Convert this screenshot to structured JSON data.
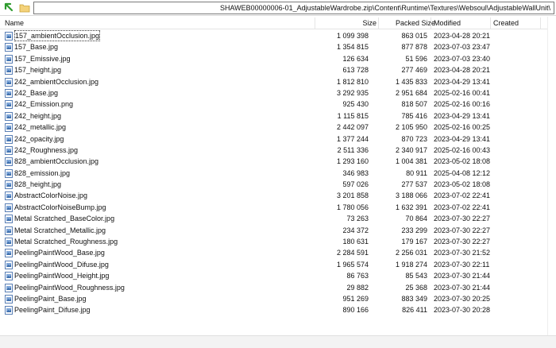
{
  "address": {
    "path": "SHAWEB00000006-01_AdjustableWardrobe.zip\\Content\\Runtime\\Textures\\Websoul\\AdjustableWallUnit\\",
    "up_icon": "green-up-arrow-icon",
    "folder_icon": "folder-icon"
  },
  "columns": {
    "name": "Name",
    "size": "Size",
    "packed": "Packed Size",
    "modified": "Modified",
    "created": "Created"
  },
  "files": [
    {
      "name": "157_ambientOcclusion.jpg",
      "size": "1 099 398",
      "packed": "863 015",
      "modified": "2023-04-28 20:21"
    },
    {
      "name": "157_Base.jpg",
      "size": "1 354 815",
      "packed": "877 878",
      "modified": "2023-07-03 23:47"
    },
    {
      "name": "157_Emissive.jpg",
      "size": "126 634",
      "packed": "51 596",
      "modified": "2023-07-03 23:40"
    },
    {
      "name": "157_height.jpg",
      "size": "613 728",
      "packed": "277 469",
      "modified": "2023-04-28 20:21"
    },
    {
      "name": "242_ambientOcclusion.jpg",
      "size": "1 812 810",
      "packed": "1 435 833",
      "modified": "2023-04-29 13:41"
    },
    {
      "name": "242_Base.jpg",
      "size": "3 292 935",
      "packed": "2 951 684",
      "modified": "2025-02-16 00:41"
    },
    {
      "name": "242_Emission.png",
      "size": "925 430",
      "packed": "818 507",
      "modified": "2025-02-16 00:16"
    },
    {
      "name": "242_height.jpg",
      "size": "1 115 815",
      "packed": "785 416",
      "modified": "2023-04-29 13:41"
    },
    {
      "name": "242_metallic.jpg",
      "size": "2 442 097",
      "packed": "2 105 950",
      "modified": "2025-02-16 00:25"
    },
    {
      "name": "242_opacity.jpg",
      "size": "1 377 244",
      "packed": "870 723",
      "modified": "2023-04-29 13:41"
    },
    {
      "name": "242_Roughness.jpg",
      "size": "2 511 336",
      "packed": "2 340 917",
      "modified": "2025-02-16 00:43"
    },
    {
      "name": "828_ambientOcclusion.jpg",
      "size": "1 293 160",
      "packed": "1 004 381",
      "modified": "2023-05-02 18:08"
    },
    {
      "name": "828_emission.jpg",
      "size": "346 983",
      "packed": "80 911",
      "modified": "2025-04-08 12:12"
    },
    {
      "name": "828_height.jpg",
      "size": "597 026",
      "packed": "277 537",
      "modified": "2023-05-02 18:08"
    },
    {
      "name": "AbstractColorNoise.jpg",
      "size": "3 201 858",
      "packed": "3 188 066",
      "modified": "2023-07-02 22:41"
    },
    {
      "name": "AbstractColorNoiseBump.jpg",
      "size": "1 780 056",
      "packed": "1 632 391",
      "modified": "2023-07-02 22:41"
    },
    {
      "name": "Metal Scratched_BaseColor.jpg",
      "size": "73 263",
      "packed": "70 864",
      "modified": "2023-07-30 22:27"
    },
    {
      "name": "Metal Scratched_Metallic.jpg",
      "size": "234 372",
      "packed": "233 299",
      "modified": "2023-07-30 22:27"
    },
    {
      "name": "Metal Scratched_Roughness.jpg",
      "size": "180 631",
      "packed": "179 167",
      "modified": "2023-07-30 22:27"
    },
    {
      "name": "PeelingPaintWood_Base.jpg",
      "size": "2 284 591",
      "packed": "2 256 031",
      "modified": "2023-07-30 21:52"
    },
    {
      "name": "PeelingPaintWood_Difuse.jpg",
      "size": "1 965 574",
      "packed": "1 918 274",
      "modified": "2023-07-30 22:11"
    },
    {
      "name": "PeelingPaintWood_Height.jpg",
      "size": "86 763",
      "packed": "85 543",
      "modified": "2023-07-30 21:44"
    },
    {
      "name": "PeelingPaintWood_Roughness.jpg",
      "size": "29 882",
      "packed": "25 368",
      "modified": "2023-07-30 21:44"
    },
    {
      "name": "PeelingPaint_Base.jpg",
      "size": "951 269",
      "packed": "883 349",
      "modified": "2023-07-30 20:25"
    },
    {
      "name": "PeelingPaint_Difuse.jpg",
      "size": "890 166",
      "packed": "826 411",
      "modified": "2023-07-30 20:28"
    }
  ]
}
